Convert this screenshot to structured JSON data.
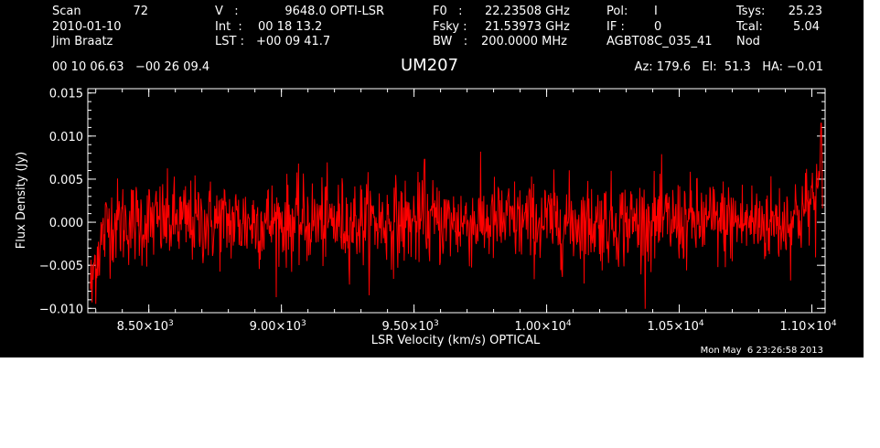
{
  "header": {
    "col1": [
      "Scan",
      "2010-01-10",
      "Jim Braatz"
    ],
    "scan_number": "72",
    "col2_labels": [
      "V   :",
      "Int  :",
      "LST :"
    ],
    "col2_values": [
      "9648.0 OPTI-LSR",
      "00 18 13.2",
      "+00 09 41.7"
    ],
    "col3_labels": [
      "F0   :",
      "Fsky :",
      "BW   :"
    ],
    "col3_values": [
      "22.23508 GHz",
      "21.53973 GHz",
      "200.0000 MHz"
    ],
    "col4_labels": [
      "Pol:",
      "IF :"
    ],
    "col4_values": [
      "I",
      "0"
    ],
    "project": "AGBT08C_035_41",
    "col5_labels": [
      "Tsys:",
      "Tcal:"
    ],
    "col5_values": [
      "25.23",
      "5.04"
    ],
    "mode": "Nod",
    "coords": "00 10 06.63   −00 26 09.4",
    "source": "UM207",
    "azel": "Az: 179.6   El:  51.3   HA: −0.01",
    "timestamp": "Mon May  6 23:26:58 2013"
  },
  "chart_data": {
    "type": "line",
    "title": "UM207",
    "xlabel": "LSR Velocity (km/s) OPTICAL",
    "ylabel": "Flux Density (Jy)",
    "xlim": [
      8270,
      11050
    ],
    "ylim": [
      -0.0105,
      0.0155
    ],
    "xticks": [
      8500,
      9000,
      9500,
      10000,
      10500,
      11000
    ],
    "xtick_labels": [
      {
        "mant": "8.50×10",
        "exp": "3"
      },
      {
        "mant": "9.00×10",
        "exp": "3"
      },
      {
        "mant": "9.50×10",
        "exp": "3"
      },
      {
        "mant": "1.00×10",
        "exp": "4"
      },
      {
        "mant": "1.05×10",
        "exp": "4"
      },
      {
        "mant": "1.10×10",
        "exp": "4"
      }
    ],
    "yticks": [
      -0.01,
      -0.005,
      0.0,
      0.005,
      0.01,
      0.015
    ],
    "ytick_labels": [
      "−0.010",
      "−0.005",
      "0.000",
      "0.005",
      "0.010",
      "0.015"
    ],
    "series": [
      {
        "color": "#ff0000",
        "x_start": 8280,
        "x_end": 11040,
        "n_channels": 1380,
        "noise_rms": 0.0025,
        "band_edges": [
          {
            "x": 8280,
            "y": -0.007
          },
          {
            "x": 8310,
            "y": -0.003
          },
          {
            "x": 8350,
            "y": 0.0
          },
          {
            "x": 10900,
            "y": 0.0
          },
          {
            "x": 10980,
            "y": 0.0015
          },
          {
            "x": 11030,
            "y": 0.004
          }
        ],
        "peaks": [
          {
            "x": 8286,
            "y": -0.0093
          },
          {
            "x": 9540,
            "y": 0.0073
          },
          {
            "x": 11035,
            "y": 0.0115
          }
        ]
      }
    ],
    "grid": false
  }
}
